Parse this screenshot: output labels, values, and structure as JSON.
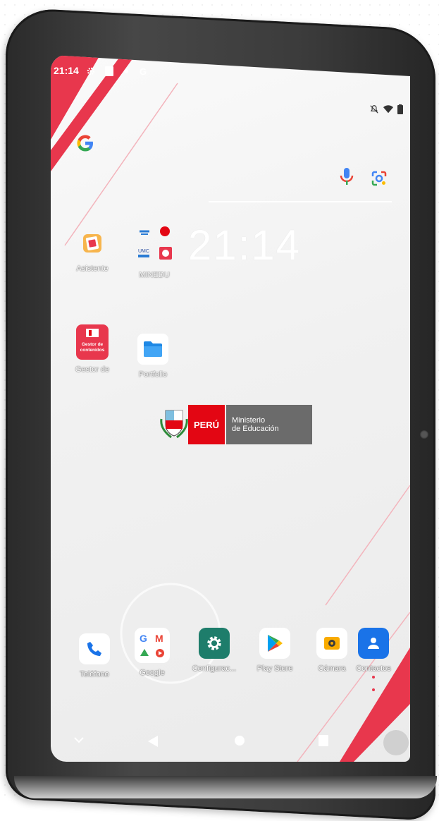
{
  "status_bar": {
    "time": "21:14",
    "left_icons": [
      "settings-icon",
      "sim-card-icon",
      "dot-icon",
      "google-g-icon"
    ],
    "right_icons": [
      "mute-icon",
      "wifi-icon",
      "battery-icon"
    ]
  },
  "search": {
    "logo": "G",
    "mic_icon": "microphone-icon",
    "lens_icon": "google-lens-icon"
  },
  "clock_widget": {
    "time": "21:14"
  },
  "home_apps": [
    {
      "label": "Asistente",
      "icon": "assistant-icon"
    },
    {
      "label": "MINEDU",
      "icon": "minedu-folder-icon"
    },
    {
      "label": "Gestor de",
      "icon": "gestor-de-contenidos-icon",
      "tile_text": "Gestor de contenidos"
    },
    {
      "label": "Portfolio",
      "icon": "folder-icon"
    }
  ],
  "minedu_logo": {
    "peru": "PERÚ",
    "line1": "Ministerio",
    "line2": "de Educación"
  },
  "dock": [
    {
      "label": "Teléfono",
      "icon": "phone-icon"
    },
    {
      "label": "Google",
      "icon": "google-folder-icon"
    },
    {
      "label": "Configurac...",
      "icon": "settings-gear-icon"
    },
    {
      "label": "Play Store",
      "icon": "play-store-icon"
    },
    {
      "label": "Cámara",
      "icon": "camera-icon"
    },
    {
      "label": "Contactos",
      "icon": "contacts-icon"
    }
  ],
  "navbar": {
    "buttons": [
      "chevron-down-icon",
      "back-icon",
      "home-icon",
      "recents-icon"
    ]
  },
  "colors": {
    "accent_red": "#e8374d",
    "peru_red": "#e30613",
    "ministerio_gray": "#6b6b6b",
    "settings_green": "#1e7d6b",
    "contacts_blue": "#1a73e8"
  }
}
